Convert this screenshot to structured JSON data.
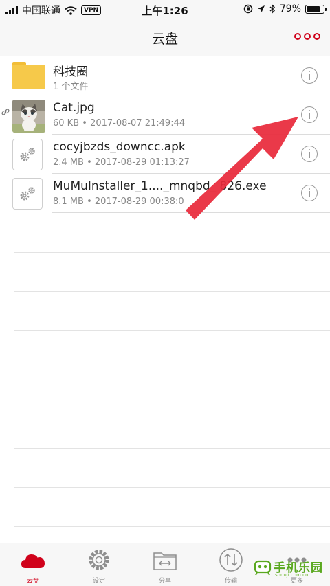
{
  "status_bar": {
    "carrier": "中国联通",
    "vpn": "VPN",
    "time": "上午1:26",
    "battery": "79%",
    "battery_level": 0.79
  },
  "nav": {
    "title": "云盘"
  },
  "files": [
    {
      "icon": "folder-icon",
      "name": "科技圈",
      "meta": "1 个文件"
    },
    {
      "icon": "cat-photo-thumbnail",
      "name": "Cat.jpg",
      "meta": "60 KB • 2017-08-07 21:49:44",
      "shared": true
    },
    {
      "icon": "gear-file-icon",
      "name": "cocyjbzds_downcc.apk",
      "meta": "2.4 MB • 2017-08-29 01:13:27"
    },
    {
      "icon": "gear-file-icon",
      "name": "MuMuInstaller_1...._mnqbd_   826.exe",
      "meta": "8.1 MB • 2017-08-29 00:38:0"
    }
  ],
  "tabs": [
    {
      "label": "云盘",
      "icon": "cloud-icon",
      "active": true
    },
    {
      "label": "设定",
      "icon": "gear-icon"
    },
    {
      "label": "分享",
      "icon": "share-folder-icon"
    },
    {
      "label": "传输",
      "icon": "transfer-icon"
    },
    {
      "label": "更多",
      "icon": "more-icon"
    }
  ],
  "watermark": {
    "text": "手机乐园",
    "sub": "shouji.com.cn"
  },
  "colors": {
    "accent": "#d0021b",
    "folder": "#f6c94a",
    "annotation_arrow": "#e8283a",
    "watermark": "#5aa81f"
  }
}
